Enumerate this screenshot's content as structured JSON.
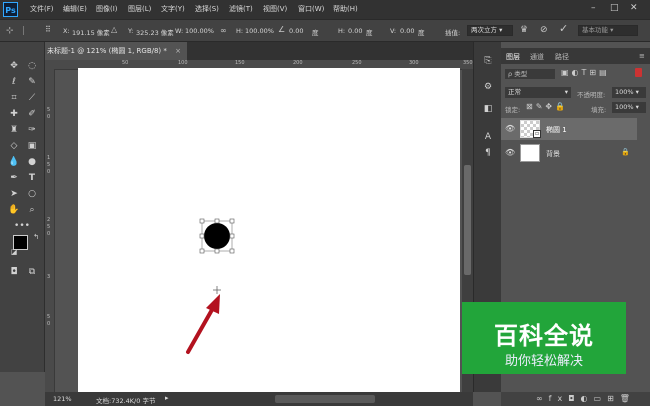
{
  "app": {
    "logo": "Ps",
    "brand_color": "#31a8ff"
  },
  "menubar": {
    "items": [
      "文件(F)",
      "编辑(E)",
      "图像(I)",
      "图层(L)",
      "文字(Y)",
      "选择(S)",
      "滤镜(T)",
      "视图(V)",
      "窗口(W)",
      "帮助(H)"
    ],
    "window_controls": {
      "minimize": "–",
      "maximize": "□",
      "close": "✕"
    }
  },
  "options": {
    "x_label": "X:",
    "x_value": "191.15 像素",
    "y_label": "Y:",
    "y_value": "325.23 像素",
    "w_label": "W:",
    "w_value": "100.00%",
    "h_label": "H:",
    "h_value": "100.00%",
    "angle_value": "0.00",
    "hskew_label": "H:",
    "hskew_value": "0.00",
    "vskew_label": "V:",
    "vskew_value": "0.00",
    "interp_label": "插值:",
    "interp_value": "两次立方",
    "workspace": "基本功能"
  },
  "document": {
    "tab_title": "未标题-1 @ 121% (椭圆 1, RGB/8) *",
    "close": "×"
  },
  "rulers": {
    "top": [
      "50",
      "100",
      "150",
      "200",
      "250",
      "300",
      "350"
    ],
    "left": [
      "5",
      "0",
      "1",
      "5",
      "0",
      "2",
      "5",
      "0",
      "3",
      "5",
      "0"
    ]
  },
  "statusbar": {
    "zoom": "121%",
    "doc_info": "文档:732.4K/0 字节"
  },
  "panel": {
    "tabs": [
      "图层",
      "通道",
      "路径"
    ],
    "filter_label": "ρ 类型",
    "blend_mode": "正常",
    "opacity_label": "不透明度:",
    "opacity_value": "100%",
    "lock_label": "锁定:",
    "fill_label": "填充:",
    "fill_value": "100%",
    "layers": [
      {
        "name": "椭圆 1",
        "selected": true
      },
      {
        "name": "背景",
        "selected": false
      }
    ]
  },
  "watermark": {
    "title": "百科全说",
    "subtitle": "助你轻松解决",
    "color": "#22a53a"
  }
}
